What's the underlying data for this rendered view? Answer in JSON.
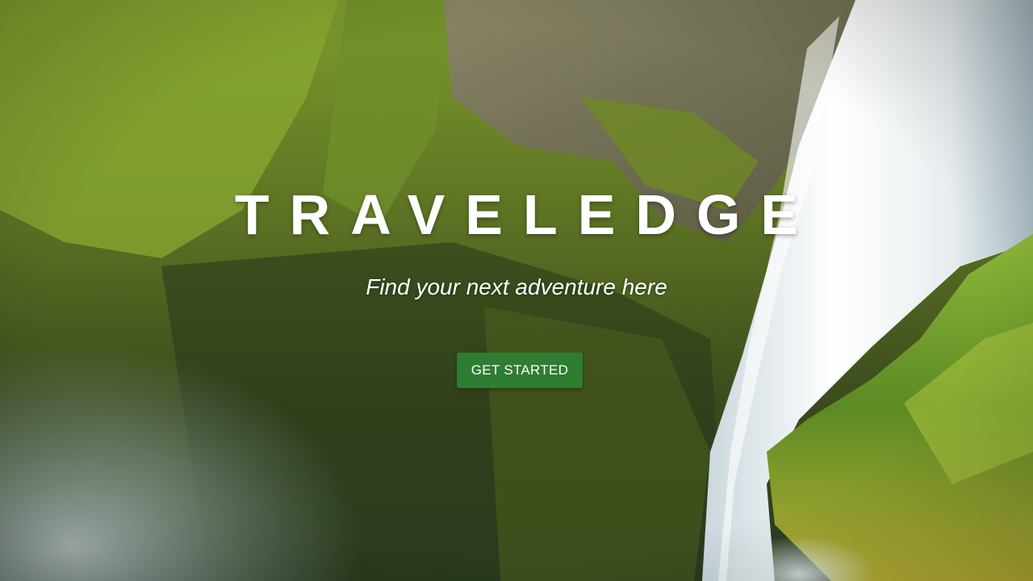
{
  "hero": {
    "title": "TRAVELEDGE",
    "tagline": "Find your next adventure here",
    "cta_label": "GET STARTED",
    "background": "waterfall-cliff-photo"
  },
  "colors": {
    "cta_button": "#2e7d32",
    "text": "#ffffff"
  }
}
